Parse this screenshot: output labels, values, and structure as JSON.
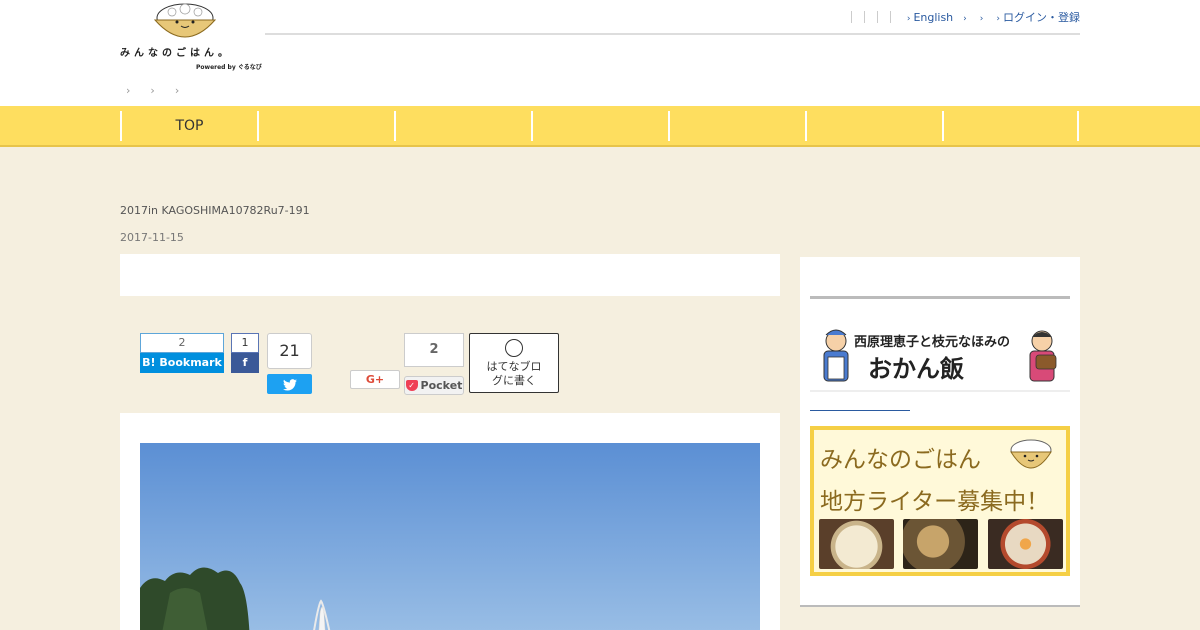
{
  "header": {
    "logo_text": "みんなのごはん。",
    "logo_powered": "Powered by ぐるなび",
    "lang_links": [
      "English",
      "",
      "",
      "ログイン・登録"
    ],
    "breadcrumb_count": 3
  },
  "nav": {
    "items": [
      "TOP",
      "",
      "",
      "",
      "",
      "",
      ""
    ]
  },
  "post": {
    "title": "2017in KAGOSHIMA10782Ru7-191",
    "date": "2017-11-15"
  },
  "share": {
    "hatena_count": "2",
    "hatena_label": "B! Bookmark",
    "facebook_count": "1",
    "facebook_label": "f",
    "twitter_count": "21",
    "gplus_label": "G+",
    "pocket_count": "2",
    "pocket_label": "Pocket",
    "hatena_blog_label": "はてなブログに書く"
  },
  "sidebar": {
    "banner1_title": "西原理恵子と枝元なほみの",
    "banner1_big": "おかん飯",
    "banner2_line1": "みんなのごはん",
    "banner2_line2": "地方ライター募集中！"
  },
  "colors": {
    "nav_bg": "#fede5f",
    "page_bg": "#f5efdf",
    "hatena": "#008fde",
    "facebook": "#3b5998",
    "twitter": "#1da1f2",
    "pocket": "#ef4056"
  }
}
